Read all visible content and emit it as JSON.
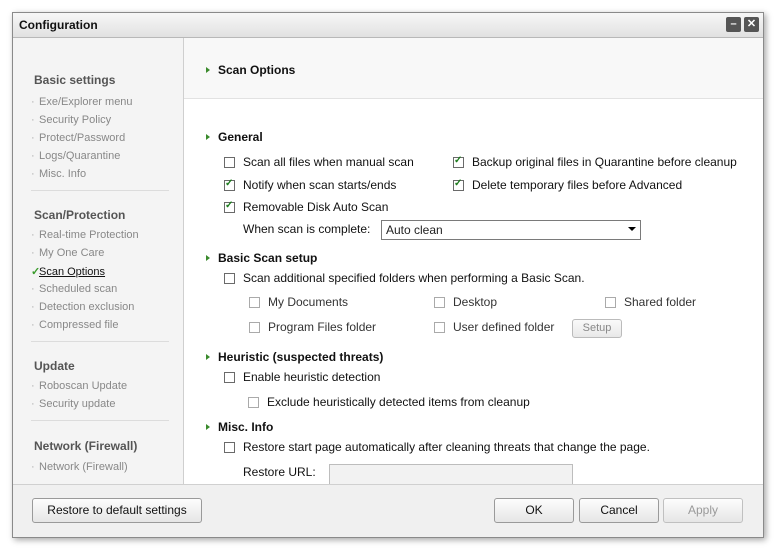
{
  "window": {
    "title": "Configuration"
  },
  "sidebar": {
    "groups": [
      {
        "title": "Basic settings",
        "items": [
          "Exe/Explorer menu",
          "Security Policy",
          "Protect/Password",
          "Logs/Quarantine",
          "Misc. Info"
        ]
      },
      {
        "title": "Scan/Protection",
        "items": [
          "Real-time Protection",
          "My One Care",
          "Scan Options",
          "Scheduled scan",
          "Detection exclusion",
          "Compressed file"
        ]
      },
      {
        "title": "Update",
        "items": [
          "Roboscan Update",
          "Security update"
        ]
      },
      {
        "title": "Network (Firewall)",
        "items": [
          "Network (Firewall)"
        ]
      }
    ],
    "active_item": "Scan Options"
  },
  "content": {
    "title": "Scan Options",
    "general": {
      "title": "General",
      "scan_all": {
        "label": "Scan all files when manual scan",
        "checked": false
      },
      "backup_quarantine": {
        "label": "Backup original files in Quarantine before cleanup",
        "checked": true
      },
      "notify": {
        "label": "Notify when scan starts/ends",
        "checked": true
      },
      "delete_temp": {
        "label": "Delete temporary files before Advanced",
        "checked": true
      },
      "removable": {
        "label": "Removable Disk Auto Scan",
        "checked": true
      },
      "when_complete_label": "When scan is complete:",
      "when_complete_value": "Auto clean"
    },
    "basic_scan": {
      "title": "Basic Scan setup",
      "additional": {
        "label": "Scan additional specified folders when performing a Basic Scan.",
        "checked": false
      },
      "my_documents": "My Documents",
      "desktop": "Desktop",
      "shared_folder": "Shared folder",
      "program_files": "Program Files folder",
      "user_defined": "User defined folder",
      "setup_label": "Setup"
    },
    "heuristic": {
      "title": "Heuristic (suspected threats)",
      "enable": {
        "label": "Enable heuristic detection",
        "checked": false
      },
      "exclude": {
        "label": "Exclude heuristically detected items from cleanup",
        "checked": false
      }
    },
    "misc": {
      "title": "Misc. Info",
      "restore_start": {
        "label": "Restore start page automatically after cleaning threats that change the page.",
        "checked": false
      },
      "restore_url_label": "Restore URL:",
      "restore_url_value": ""
    }
  },
  "footer": {
    "restore_default": "Restore to default settings",
    "ok": "OK",
    "cancel": "Cancel",
    "apply": "Apply"
  },
  "colors": {
    "accent_green": "#3a8a2c",
    "window_bg": "#f4f4f4"
  }
}
